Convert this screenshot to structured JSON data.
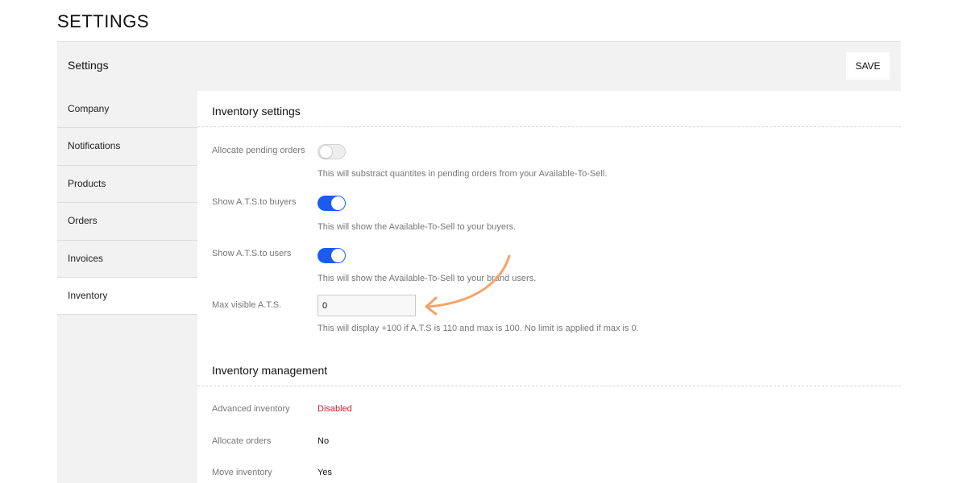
{
  "page": {
    "title": "SETTINGS"
  },
  "header": {
    "title": "Settings",
    "save_label": "SAVE"
  },
  "sidebar": {
    "items": [
      {
        "label": "Company"
      },
      {
        "label": "Notifications"
      },
      {
        "label": "Products"
      },
      {
        "label": "Orders"
      },
      {
        "label": "Invoices"
      },
      {
        "label": "Inventory",
        "active": true
      }
    ]
  },
  "inventory_settings": {
    "title": "Inventory settings",
    "allocate_pending": {
      "label": "Allocate pending orders",
      "enabled": false,
      "help": "This will substract quantites in pending orders from your Available-To-Sell."
    },
    "show_ats_buyers": {
      "label": "Show A.T.S.to buyers",
      "enabled": true,
      "help": "This will show the Available-To-Sell to your buyers."
    },
    "show_ats_users": {
      "label": "Show A.T.S.to users",
      "enabled": true,
      "help": "This will show the Available-To-Sell to your brand users."
    },
    "max_visible_ats": {
      "label": "Max visible A.T.S.",
      "value": "0",
      "help": "This will display +100 if A.T.S is 110 and max is 100. No limit is applied if max is 0."
    }
  },
  "inventory_management": {
    "title": "Inventory management",
    "rows": [
      {
        "label": "Advanced inventory",
        "value": "Disabled"
      },
      {
        "label": "Allocate orders",
        "value": "No"
      },
      {
        "label": "Move inventory",
        "value": "Yes"
      }
    ]
  },
  "colors": {
    "toggle_on": "#1a5cf0",
    "disabled_status": "#d11a2a",
    "annotation_arrow": "#f4a46a"
  }
}
